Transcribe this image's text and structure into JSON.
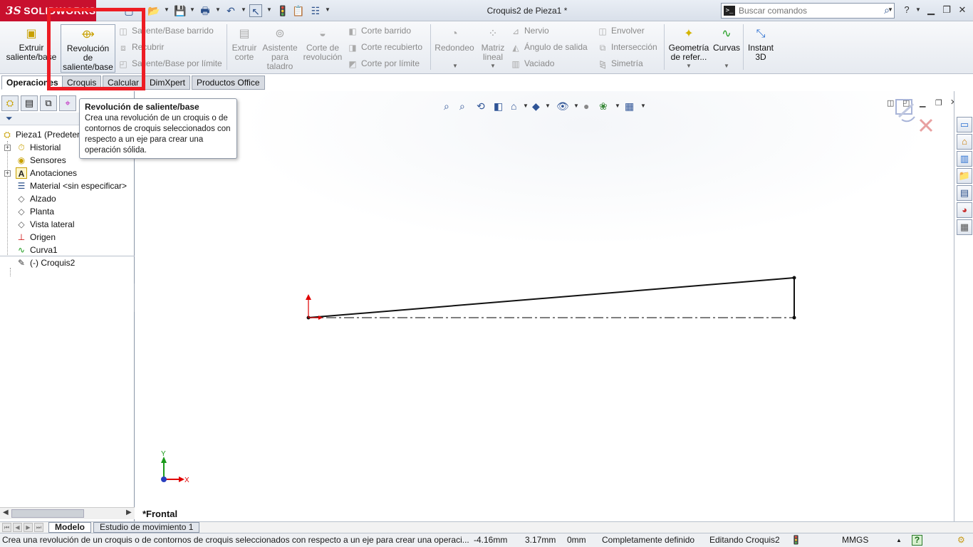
{
  "app": {
    "brand_ds": "3S",
    "brand_name": "SOLIDWORKS",
    "document_title": "Croquis2 de Pieza1 *"
  },
  "search": {
    "placeholder": "Buscar comandos"
  },
  "ribbon": {
    "extrude": "Extruir saliente/base",
    "revolve": "Revolución de saliente/base",
    "swept_boss": "Saliente/Base barrido",
    "loft_boss": "Recubrir",
    "boundary_boss": "Saliente/Base por límite",
    "extrude_cut": "Extruir corte",
    "hole_wizard": "Asistente para taladro",
    "revolve_cut": "Corte de revolución",
    "swept_cut": "Corte barrido",
    "lofted_cut": "Corte recubierto",
    "boundary_cut": "Corte por límite",
    "fillet": "Redondeo",
    "linear_pattern": "Matriz lineal",
    "rib": "Nervio",
    "draft": "Ángulo de salida",
    "shell": "Vaciado",
    "wrap": "Envolver",
    "intersect": "Intersección",
    "mirror": "Simetría",
    "ref_geometry": "Geometría de refer...",
    "curves": "Curvas",
    "instant3d": "Instant 3D"
  },
  "tabs": [
    "Operaciones",
    "Croquis",
    "Calcular",
    "DimXpert",
    "Productos Office"
  ],
  "tooltip": {
    "title": "Revolución de saliente/base",
    "body": "Crea una revolución de un croquis o de contornos de croquis seleccionados con respecto a un eje para crear una operación sólida."
  },
  "tree": {
    "root": "Pieza1  (Predeter",
    "items": [
      "Historial",
      "Sensores",
      "Anotaciones",
      "Material <sin especificar>",
      "Alzado",
      "Planta",
      "Vista lateral",
      "Origen",
      "Curva1",
      "(-) Croquis2"
    ]
  },
  "graphics": {
    "view_label": "*Frontal",
    "triad_x": "X",
    "triad_y": "Y"
  },
  "bottom_tabs": [
    "Modelo",
    "Estudio de movimiento 1"
  ],
  "status": {
    "message": "Crea una revolución de un croquis o de contornos de croquis seleccionados con respecto a un eje para crear una operaci...",
    "x": "-4.16mm",
    "y": "3.17mm",
    "z": "0mm",
    "sketch_state": "Completamente definido",
    "editing": "Editando Croquis2",
    "units": "MMGS"
  },
  "colors": {
    "brand_red": "#c8102e",
    "highlight_red": "#ed1c24",
    "origin_red": "#e00000",
    "triad_green": "#1a9a1a"
  }
}
